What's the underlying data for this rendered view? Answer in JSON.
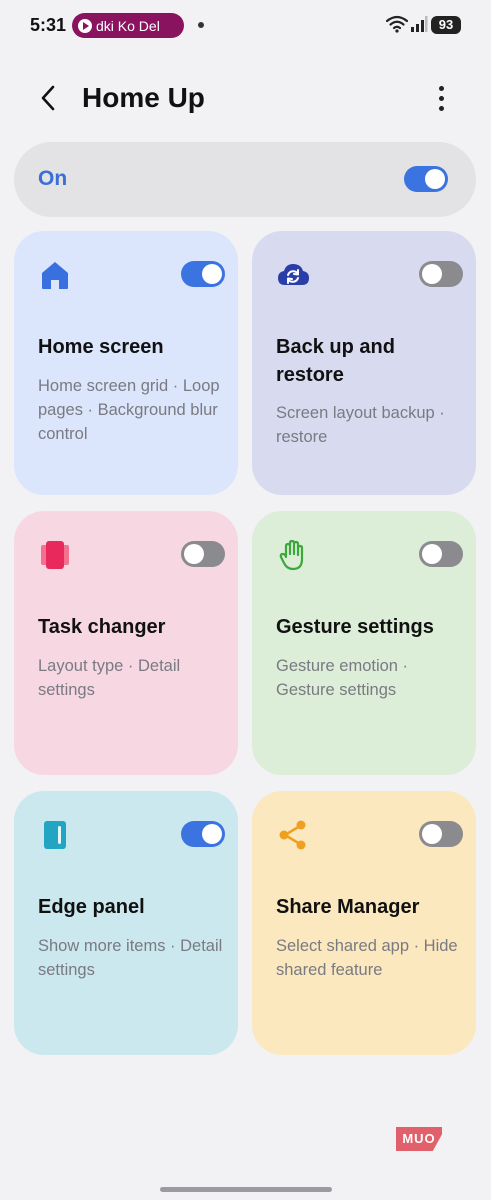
{
  "status_bar": {
    "time": "5:31",
    "media_text": "dki Ko Del",
    "battery": "93"
  },
  "header": {
    "title": "Home Up"
  },
  "master_switch": {
    "label": "On",
    "state": "on"
  },
  "cards": [
    {
      "title": "Home screen",
      "description": "Home screen grid · Loop pages · Background blur control",
      "toggle": "on",
      "icon": "home-icon",
      "color": "#dbe5fb"
    },
    {
      "title": "Back up and restore",
      "description": "Screen layout backup · restore",
      "toggle": "off",
      "icon": "cloud-sync-icon",
      "color": "#d8dbf0"
    },
    {
      "title": "Task changer",
      "description": "Layout type · Detail settings",
      "toggle": "off",
      "icon": "task-cards-icon",
      "color": "#f7d8e2"
    },
    {
      "title": "Gesture settings",
      "description": "Gesture emotion · Gesture settings",
      "toggle": "off",
      "icon": "hand-icon",
      "color": "#dcedd8"
    },
    {
      "title": "Edge panel",
      "description": "Show more items · Detail settings",
      "toggle": "on",
      "icon": "edge-panel-icon",
      "color": "#cbe8ee"
    },
    {
      "title": "Share Manager",
      "description": "Select shared app · Hide shared feature",
      "toggle": "off",
      "icon": "share-icon",
      "color": "#fbe8be"
    }
  ],
  "watermark": "MUO",
  "colors": {
    "accent": "#3b74e0",
    "toggle_off": "#8b8b8f",
    "background": "#f2f2f4"
  }
}
